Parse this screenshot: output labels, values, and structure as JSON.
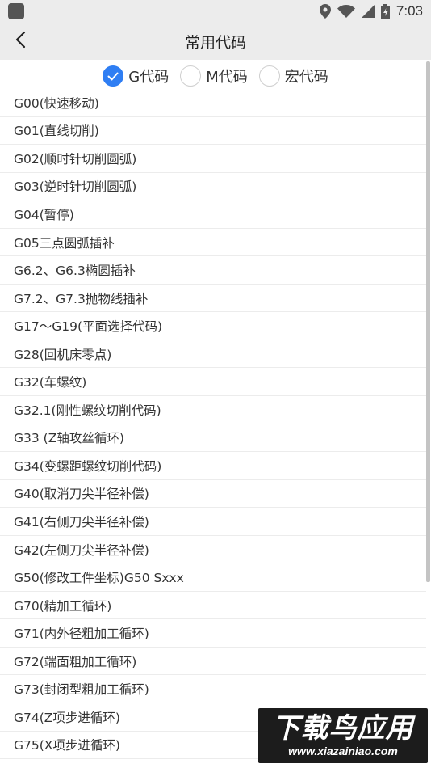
{
  "status_bar": {
    "time": "7:03"
  },
  "header": {
    "title": "常用代码"
  },
  "tabs": [
    {
      "label": "G代码",
      "checked": true
    },
    {
      "label": "M代码",
      "checked": false
    },
    {
      "label": "宏代码",
      "checked": false
    }
  ],
  "codes": [
    "G00(快速移动)",
    "G01(直线切削)",
    "G02(顺时针切削圆弧)",
    "G03(逆时针切削圆弧)",
    "G04(暂停)",
    "G05三点圆弧插补",
    "G6.2、G6.3椭圆插补",
    "G7.2、G7.3抛物线插补",
    "G17～G19(平面选择代码)",
    "G28(回机床零点)",
    "G32(车螺纹)",
    "G32.1(刚性螺纹切削代码)",
    "G33 (Z轴攻丝循环)",
    "G34(变螺距螺纹切削代码)",
    "G40(取消刀尖半径补偿)",
    "G41(右侧刀尖半径补偿)",
    "G42(左侧刀尖半径补偿)",
    "G50(修改工件坐标)G50 Sxxx",
    "G70(精加工循环)",
    "G71(内外径粗加工循环)",
    "G72(端面粗加工循环)",
    "G73(封闭型粗加工循环)",
    "G74(Z项步进循环)",
    "G75(X项步进循环)"
  ],
  "watermark": {
    "big": "下载鸟应用",
    "small": "www.xiazainiao.com"
  },
  "colors": {
    "accent": "#2f7ef3",
    "bar_bg": "#ececec"
  }
}
